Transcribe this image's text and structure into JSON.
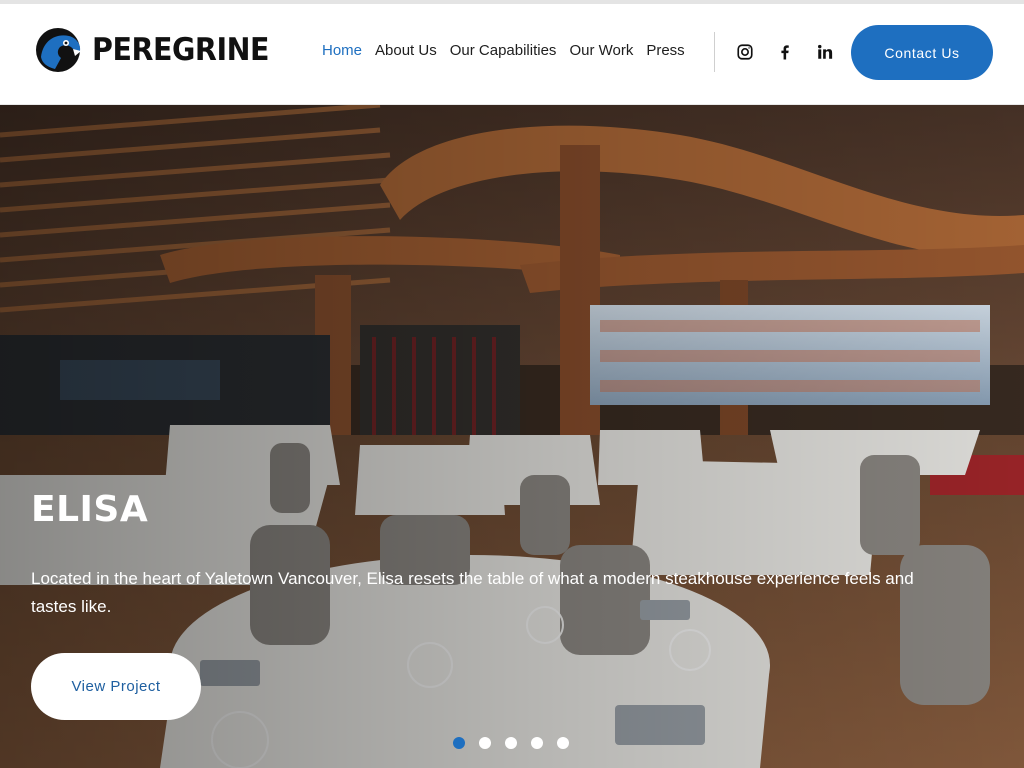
{
  "brand": {
    "name": "PEREGRINE",
    "accent_color": "#1e6fc0",
    "logo_icon": "peregrine-falcon-head-icon"
  },
  "nav": {
    "items": [
      {
        "label": "Home",
        "active": true
      },
      {
        "label": "About Us",
        "active": false
      },
      {
        "label": "Our Capabilities",
        "active": false
      },
      {
        "label": "Our Work",
        "active": false
      },
      {
        "label": "Press",
        "active": false
      }
    ]
  },
  "social": [
    "instagram-icon",
    "facebook-icon",
    "linkedin-icon"
  ],
  "header": {
    "contact_label": "Contact Us"
  },
  "hero": {
    "title": "ELISA",
    "description": "Located in the heart of Yaletown Vancouver, Elisa resets the table of what a modern steakhouse experience feels and tastes like.",
    "button_label": "View Project",
    "slides_total": 5,
    "active_slide": 1
  }
}
